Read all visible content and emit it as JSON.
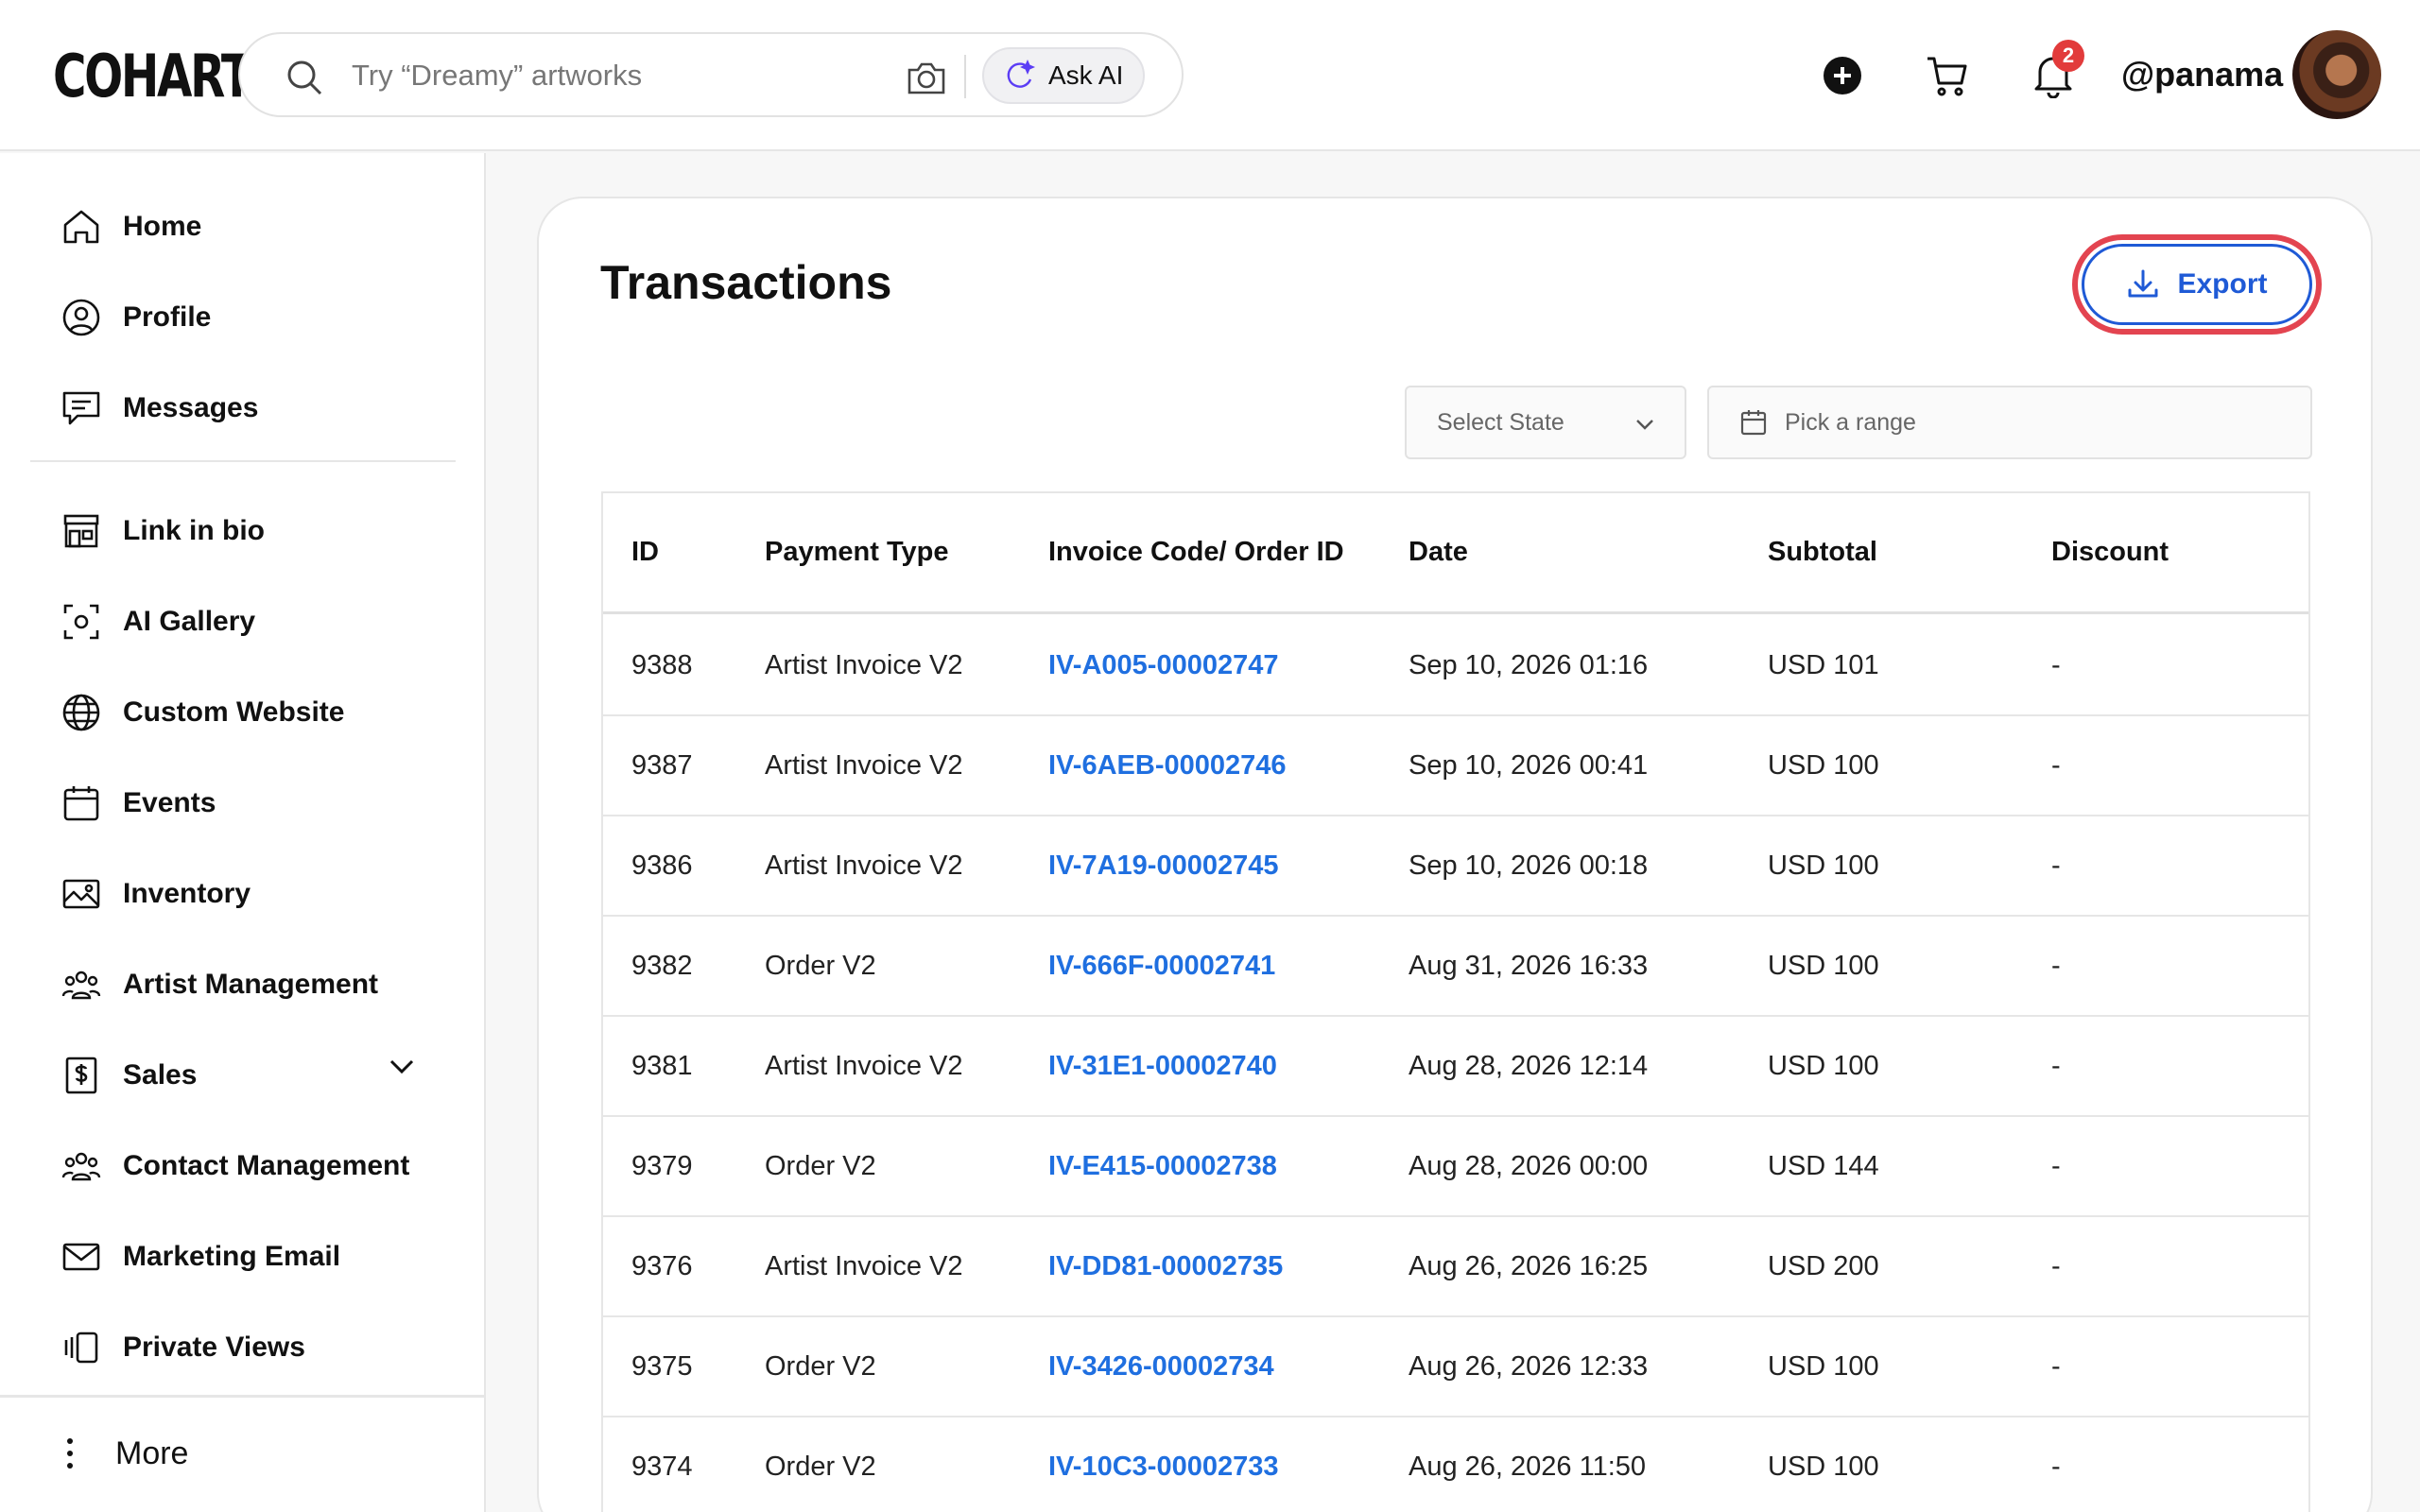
{
  "brand": {
    "logo_text": "COHART"
  },
  "search": {
    "placeholder": "Try “Dreamy” artworks",
    "ask_ai_label": "Ask AI"
  },
  "header": {
    "notifications_count": "2",
    "username": "@panama"
  },
  "sidebar": {
    "items": [
      {
        "label": "Home",
        "icon": "home-icon"
      },
      {
        "label": "Profile",
        "icon": "user-circle-icon"
      },
      {
        "label": "Messages",
        "icon": "message-icon"
      },
      {
        "label": "Link in bio",
        "icon": "storefront-icon"
      },
      {
        "label": "AI Gallery",
        "icon": "scan-icon"
      },
      {
        "label": "Custom Website",
        "icon": "globe-icon"
      },
      {
        "label": "Events",
        "icon": "calendar-icon"
      },
      {
        "label": "Inventory",
        "icon": "image-icon"
      },
      {
        "label": "Artist Management",
        "icon": "users-icon"
      },
      {
        "label": "Sales",
        "icon": "dollar-doc-icon"
      },
      {
        "label": "Contact Management",
        "icon": "users-icon"
      },
      {
        "label": "Marketing Email",
        "icon": "mail-icon"
      },
      {
        "label": "Private Views",
        "icon": "gallery-stack-icon"
      }
    ],
    "more_label": "More"
  },
  "main": {
    "title": "Transactions",
    "export_label": "Export",
    "filters": {
      "state_placeholder": "Select State",
      "range_placeholder": "Pick a range"
    },
    "table": {
      "columns": [
        "ID",
        "Payment Type",
        "Invoice Code/ Order ID",
        "Date",
        "Subtotal",
        "Discount"
      ],
      "rows": [
        {
          "id": "9388",
          "type": "Artist Invoice V2",
          "code": "IV-A005-00002747",
          "date": "Sep 10, 2026 01:16",
          "subtotal": "USD 101",
          "discount": "-"
        },
        {
          "id": "9387",
          "type": "Artist Invoice V2",
          "code": "IV-6AEB-00002746",
          "date": "Sep 10, 2026 00:41",
          "subtotal": "USD 100",
          "discount": "-"
        },
        {
          "id": "9386",
          "type": "Artist Invoice V2",
          "code": "IV-7A19-00002745",
          "date": "Sep 10, 2026 00:18",
          "subtotal": "USD 100",
          "discount": "-"
        },
        {
          "id": "9382",
          "type": "Order V2",
          "code": "IV-666F-00002741",
          "date": "Aug 31, 2026 16:33",
          "subtotal": "USD 100",
          "discount": "-"
        },
        {
          "id": "9381",
          "type": "Artist Invoice V2",
          "code": "IV-31E1-00002740",
          "date": "Aug 28, 2026 12:14",
          "subtotal": "USD 100",
          "discount": "-"
        },
        {
          "id": "9379",
          "type": "Order V2",
          "code": "IV-E415-00002738",
          "date": "Aug 28, 2026 00:00",
          "subtotal": "USD 144",
          "discount": "-"
        },
        {
          "id": "9376",
          "type": "Artist Invoice V2",
          "code": "IV-DD81-00002735",
          "date": "Aug 26, 2026 16:25",
          "subtotal": "USD 200",
          "discount": "-"
        },
        {
          "id": "9375",
          "type": "Order V2",
          "code": "IV-3426-00002734",
          "date": "Aug 26, 2026 12:33",
          "subtotal": "USD 100",
          "discount": "-"
        },
        {
          "id": "9374",
          "type": "Order V2",
          "code": "IV-10C3-00002733",
          "date": "Aug 26, 2026 11:50",
          "subtotal": "USD 100",
          "discount": "-"
        }
      ]
    }
  },
  "colors": {
    "link": "#1f6fe0",
    "export_accent": "#1f5ad6",
    "highlight_ring": "#e34450",
    "badge": "#e23b3b"
  }
}
